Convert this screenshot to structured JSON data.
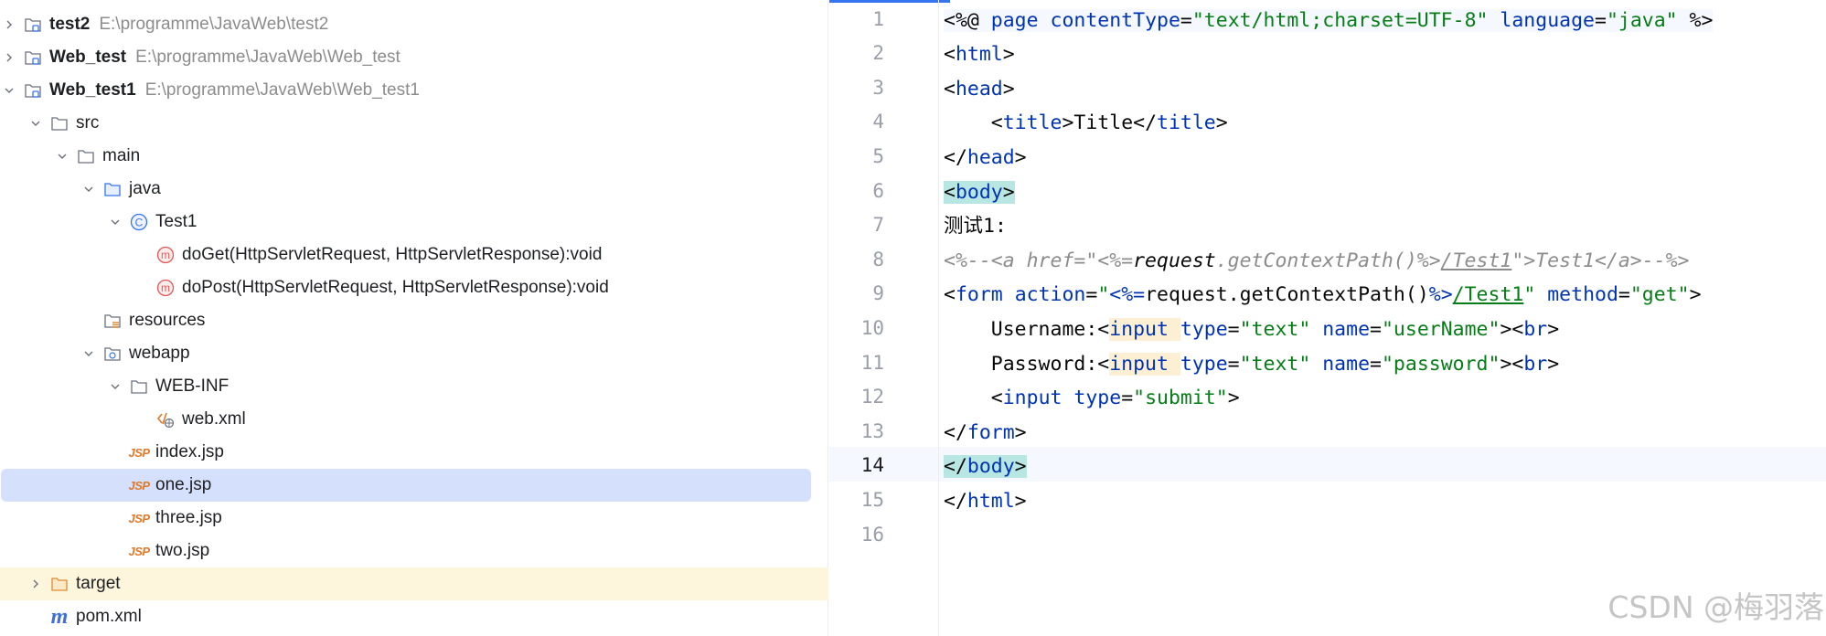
{
  "project_tree": {
    "items": [
      {
        "label": "test2",
        "path": "E:\\programme\\JavaWeb\\test2"
      },
      {
        "label": "Web_test",
        "path": "E:\\programme\\JavaWeb\\Web_test"
      },
      {
        "label": "Web_test1",
        "path": "E:\\programme\\JavaWeb\\Web_test1"
      },
      {
        "label": "src"
      },
      {
        "label": "main"
      },
      {
        "label": "java"
      },
      {
        "label": "Test1"
      },
      {
        "label": "doGet(HttpServletRequest, HttpServletResponse):void"
      },
      {
        "label": "doPost(HttpServletRequest, HttpServletResponse):void"
      },
      {
        "label": "resources"
      },
      {
        "label": "webapp"
      },
      {
        "label": "WEB-INF"
      },
      {
        "label": "web.xml"
      },
      {
        "label": "index.jsp"
      },
      {
        "label": "one.jsp"
      },
      {
        "label": "three.jsp"
      },
      {
        "label": "two.jsp"
      },
      {
        "label": "target"
      },
      {
        "label": "pom.xml"
      }
    ],
    "selected": "one.jsp",
    "jsp_badge": "JSP",
    "maven_badge": "m",
    "method_badge": "m",
    "class_badge": "C"
  },
  "editor": {
    "line_numbers": [
      "1",
      "2",
      "3",
      "4",
      "5",
      "6",
      "7",
      "8",
      "9",
      "10",
      "11",
      "12",
      "13",
      "14",
      "15",
      "16"
    ],
    "current_line": "14",
    "code": {
      "l1": {
        "a": "<%@ ",
        "b": "page ",
        "c": "contentType",
        "d": "=",
        "e": "\"text/html;charset=UTF-8\"",
        "f": " ",
        "g": "language",
        "h": "=",
        "i": "\"java\"",
        "j": " %>"
      },
      "l2": {
        "a": "<",
        "b": "html",
        ">": ">"
      },
      "l3": {
        "a": "<",
        "b": "head",
        ">": ">"
      },
      "l4": {
        "a": "    <",
        "b": "title",
        "c": ">Title</",
        "d": "title",
        ">": ">"
      },
      "l5": {
        "a": "</",
        "b": "head",
        ">": ">"
      },
      "l6": {
        "a": "<",
        "b": "body",
        ">": ">"
      },
      "l7": {
        "a": "测试1:"
      },
      "l8": {
        "a": "<%--<a href=\"<%=",
        "b": "request",
        "c": ".getContextPath()%>",
        "d": "/Test1",
        "e": "\">Test1</a>--%>"
      },
      "l9": {
        "a": "<",
        "b": "form ",
        "c": "action",
        "d": "=",
        "e": "\"",
        "f": "<%=",
        "g": "request.getContextPath()",
        "h": "%>",
        "i": "/Test1",
        "j": "\"",
        "k": " method",
        "l": "=",
        "m": "\"get\"",
        "n": ">"
      },
      "l10": {
        "a": "    Username:<",
        "b": "input ",
        "c": "type",
        "d": "=",
        "e": "\"text\"",
        "f": " name",
        "g": "=",
        "h": "\"userName\"",
        "i": "><",
        "j": "br",
        ">": ">"
      },
      "l11": {
        "a": "    Password:<",
        "b": "input ",
        "c": "type",
        "d": "=",
        "e": "\"text\"",
        "f": " name",
        "g": "=",
        "h": "\"password\"",
        "i": "><",
        "j": "br",
        ">": ">"
      },
      "l12": {
        "a": "    <",
        "b": "input ",
        "c": "type",
        "d": "=",
        "e": "\"submit\"",
        ">": ">"
      },
      "l13": {
        "a": "</",
        "b": "form",
        ">": ">"
      },
      "l14": {
        "a": "</",
        "b": "body",
        ">": ">"
      },
      "l15": {
        "a": "</",
        "b": "html",
        ">": ">"
      }
    }
  },
  "watermark": "CSDN @梅羽落",
  "colors": {
    "accent": "#3574f0",
    "selection": "#d5e1fc",
    "excluded": "#fdf6dd",
    "tag": "#0033b3",
    "string": "#067d17",
    "comment": "#8c8c8c"
  }
}
